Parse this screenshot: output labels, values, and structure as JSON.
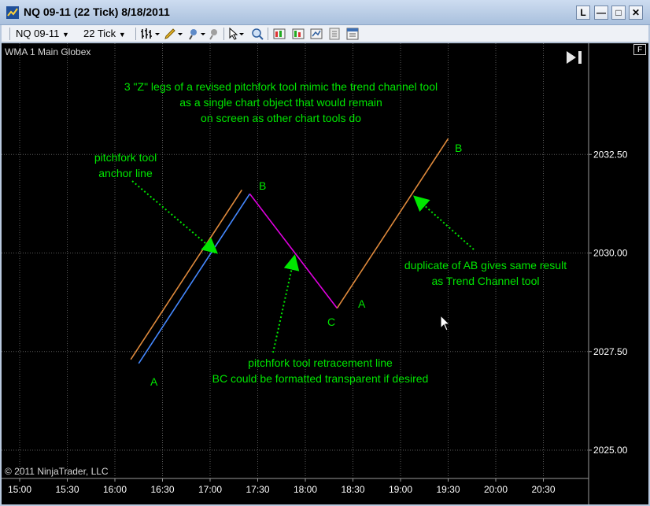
{
  "window": {
    "title": "NQ 09-11 (22 Tick)  8/18/2011",
    "buttons": {
      "layout": "L",
      "minimize": "—",
      "maximize": "□",
      "close": "✕"
    }
  },
  "toolbar": {
    "instrument": "NQ 09-11",
    "interval": "22 Tick"
  },
  "chart": {
    "indicator_label": "WMA 1 Main Globex",
    "copyright": "© 2011 NinjaTrader, LLC",
    "f_button": "F",
    "colors": {
      "background": "#000000",
      "grid": "#5a5a5a",
      "axis_text": "#ffffff",
      "annotation_text": "#00e600",
      "pitchfork_anchor": "#4488ff",
      "retracement": "#e000e0",
      "channel": "#e08a3c",
      "arrow": "#00e600"
    },
    "annotations": {
      "main_lines": [
        "3 \"Z\"  legs of a revised pitchfork tool mimic the trend channel tool",
        "as a single chart object that would remain",
        "on screen as  other chart tools do"
      ],
      "anchor_lines": [
        "pitchfork tool",
        "anchor line"
      ],
      "duplicate_lines": [
        "duplicate of AB gives same result",
        "as Trend Channel tool"
      ],
      "retracement_lines": [
        "pitchfork tool retracement line",
        "BC could be formatted transparent if desired"
      ],
      "point_labels": {
        "a1": "A",
        "b1": "B",
        "c1": "C",
        "a2": "A",
        "b2": "B"
      }
    }
  },
  "chart_data": {
    "type": "line",
    "x_ticks": [
      "15:00",
      "15:30",
      "16:00",
      "16:30",
      "17:00",
      "17:30",
      "18:00",
      "18:30",
      "19:00",
      "19:30",
      "20:00",
      "20:30"
    ],
    "y_ticks": [
      "2025.00",
      "2027.50",
      "2030.00",
      "2032.50"
    ],
    "ylim": [
      2024.5,
      2035.0
    ],
    "grid": true,
    "series": [
      {
        "points": [
          [
            "16:15",
            2027.2
          ],
          [
            "17:25",
            2031.5
          ]
        ]
      },
      {
        "points": [
          [
            "17:25",
            2031.5
          ],
          [
            "18:20",
            2028.6
          ]
        ]
      },
      {
        "points": [
          [
            "16:10",
            2027.3
          ],
          [
            "17:20",
            2031.6
          ]
        ]
      },
      {
        "points": [
          [
            "18:20",
            2028.6
          ],
          [
            "19:30",
            2032.9
          ]
        ]
      }
    ]
  }
}
